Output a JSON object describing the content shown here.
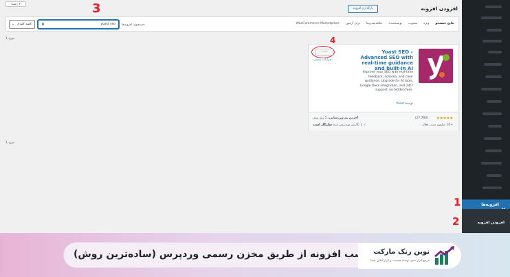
{
  "top_button_label": "راهنما ▾",
  "page_title": "افزودن افزونه",
  "upload_button": "بارگذاری افزونه",
  "filter_tabs": [
    "نتایج جستجو",
    "ویژه",
    "محبوب",
    "توصیه‌شده",
    "علاقه‌مندی‌ها",
    "برای آزمون",
    "WooCommerce Marketplace"
  ],
  "search": {
    "label": "جستجوی افزونه‌ها",
    "value": "yoast seo",
    "clear_symbol": "×",
    "keyword_select": "کلمه کلیدی"
  },
  "result_count_top": "1 مورد",
  "result_count_bottom": "1 مورد",
  "plugin": {
    "name": "Yoast SEO – Advanced SEO with real-time guidance and built-in AI",
    "description": "Improve your SEO with real-time feedback, schema, and clear guidance. Upgrade for AI tools, Google Docs integration, and 24/7 support, no hidden fees.",
    "author_prefix": "توسط",
    "author": "Yoast",
    "install_label": "نصب",
    "more_details": "جزئیات بیشتر",
    "stars": "★★★★★",
    "rating_count": "(27,760)",
    "active_installs": "+10 میلیون نصب فعال",
    "last_updated_label": "آخرین به‌روزرسانی:",
    "last_updated_value": "5 روز پیش",
    "compat_check": "✓",
    "compat_prefix": "با نگارش وردپرس شما",
    "compat_value": "سازگار است"
  },
  "sidebar": {
    "active_item": "افزونه‌ها",
    "sub_item": "افزودن افزونه"
  },
  "annotations": [
    "1",
    "2",
    "3",
    "4"
  ],
  "banner": {
    "headline": "نصب افزونه از طریق مخزن رسمی وردپرس (ساده‌ترین روش)",
    "brand_name": "نوین رنک مارکت",
    "brand_tagline": "مرجع ابزار سئو، توسعه قسمت و ابزار آنلاین شما"
  },
  "colors": {
    "accent": "#2271b1",
    "annotation_red": "#e0242f",
    "yoast_purple": "#a4286a",
    "sidebar": "#1d2327"
  }
}
